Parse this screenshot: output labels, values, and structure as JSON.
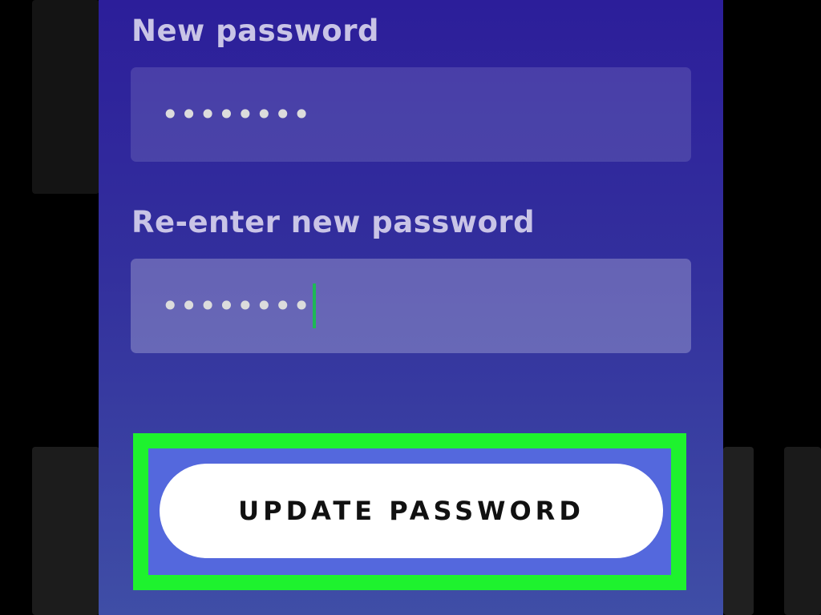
{
  "form": {
    "new_password_label": "New password",
    "new_password_value": "••••••••",
    "reenter_password_label": "Re-enter new password",
    "reenter_password_value": "••••••••"
  },
  "actions": {
    "update_password_label": "UPDATE PASSWORD"
  },
  "colors": {
    "panel_top": "#2c1e9a",
    "panel_bottom": "#3f4ea6",
    "highlight_frame": "#1ef22e",
    "caret": "#1db954",
    "button_background": "#ffffff"
  }
}
